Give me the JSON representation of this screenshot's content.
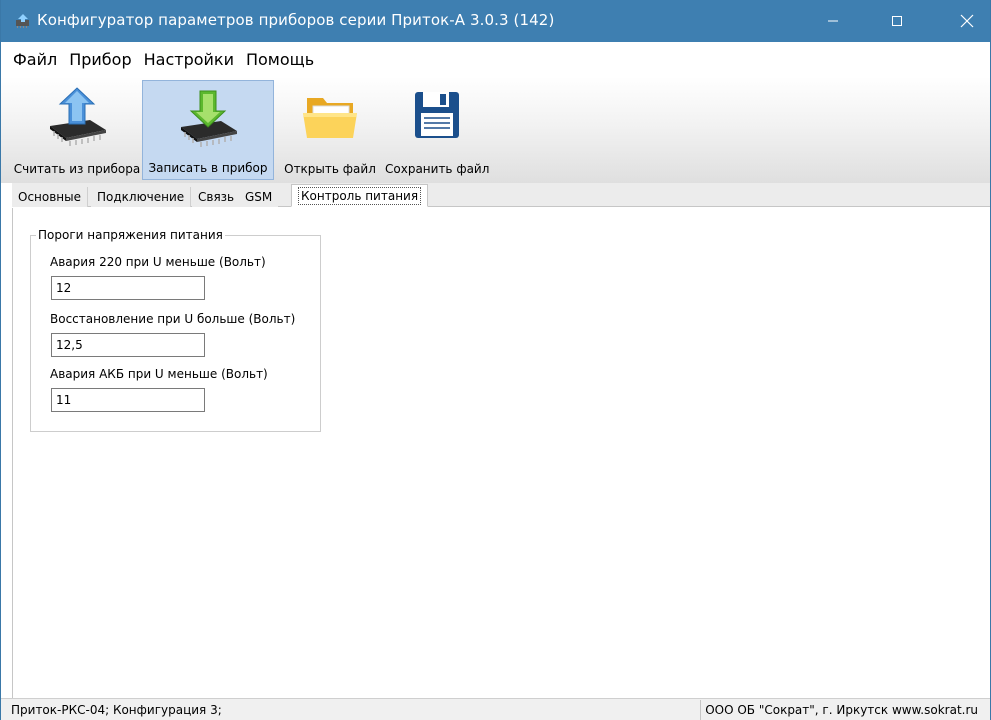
{
  "window": {
    "title": "Конфигуратор параметров приборов серии Приток-А   3.0.3 (142)",
    "accent_color": "#3e7fb1",
    "controls": [
      "minimize-icon",
      "maximize-icon",
      "close-icon"
    ]
  },
  "menu": {
    "file": "Файл",
    "device": "Прибор",
    "settings": "Настройки",
    "help": "Помощь"
  },
  "toolbar": {
    "read_label": "Считать из прибора",
    "read_icon": "chip-upload-icon",
    "write_label": "Записать в прибор",
    "write_icon": "chip-download-icon",
    "open_label": "Открыть файл",
    "open_icon": "folder-icon",
    "save_label": "Сохранить файл",
    "save_icon": "floppy-disk-icon"
  },
  "tabs": {
    "basic": "Основные",
    "connect": "Подключение",
    "link": "Связь",
    "gsm": "GSM",
    "power": "Контроль питания",
    "active": "power"
  },
  "group": {
    "title": "Пороги напряжения питания",
    "fields": [
      {
        "label": "Авария 220 при U меньше (Вольт)",
        "value": "12"
      },
      {
        "label": "Восстановление при U больше (Вольт)",
        "value": "12,5"
      },
      {
        "label": "Авария АКБ при U меньше (Вольт)",
        "value": "11"
      }
    ]
  },
  "status": {
    "left": "Приток-РКС-04; Конфигурация 3;",
    "right": "ООО ОБ \"Сократ\", г. Иркутск   www.sokrat.ru"
  }
}
